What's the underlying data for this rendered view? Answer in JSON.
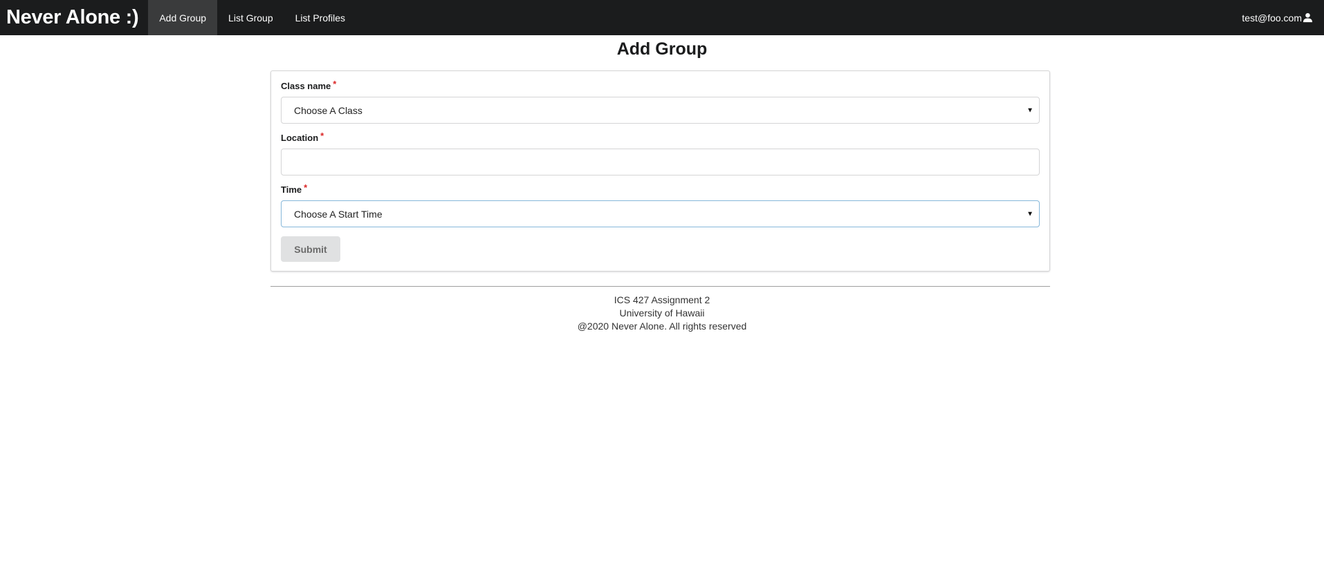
{
  "navbar": {
    "brand": "Never Alone :)",
    "items": [
      {
        "label": "Add Group",
        "active": true
      },
      {
        "label": "List Group",
        "active": false
      },
      {
        "label": "List Profiles",
        "active": false
      }
    ],
    "user_email": "test@foo.com",
    "user_icon": "user-icon"
  },
  "page": {
    "title": "Add Group"
  },
  "form": {
    "class_name": {
      "label": "Class name",
      "required_mark": "*",
      "value": "Choose A Class"
    },
    "location": {
      "label": "Location",
      "required_mark": "*",
      "value": ""
    },
    "time": {
      "label": "Time",
      "required_mark": "*",
      "value": "Choose A Start Time"
    },
    "submit_label": "Submit"
  },
  "footer": {
    "line1": "ICS 427 Assignment 2",
    "line2": "University of Hawaii",
    "line3": "@2020 Never Alone. All rights reserved"
  },
  "colors": {
    "navbar_bg": "#1b1c1d",
    "active_tab_bg": "#3a3b3c",
    "required": "#db2828",
    "focus_border": "#85b7d9",
    "button_bg": "#e0e1e2"
  }
}
